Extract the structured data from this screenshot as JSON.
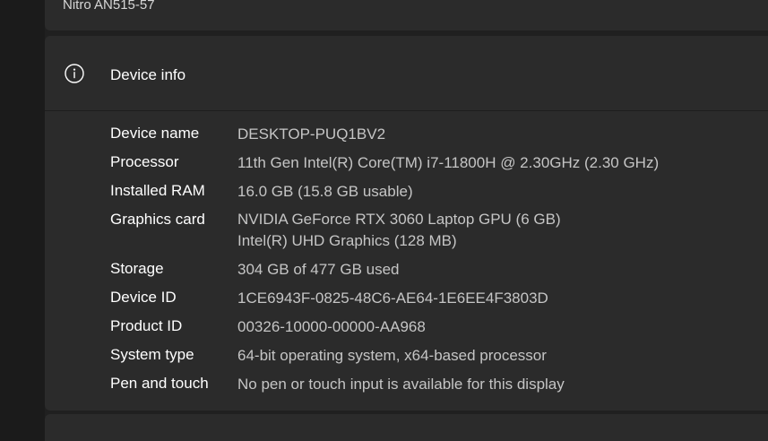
{
  "device_card": {
    "model": "Nitro AN515-57"
  },
  "device_info": {
    "title": "Device info",
    "icon": "info-icon",
    "specs": [
      {
        "label": "Device name",
        "values": [
          "DESKTOP-PUQ1BV2"
        ]
      },
      {
        "label": "Processor",
        "values": [
          "11th Gen Intel(R) Core(TM) i7-11800H @ 2.30GHz (2.30 GHz)"
        ]
      },
      {
        "label": "Installed RAM",
        "values": [
          "16.0 GB (15.8 GB usable)"
        ]
      },
      {
        "label": "Graphics card",
        "values": [
          "NVIDIA GeForce RTX 3060 Laptop GPU (6 GB)",
          "Intel(R) UHD Graphics (128 MB)"
        ]
      },
      {
        "label": "Storage",
        "values": [
          "304 GB of 477 GB used"
        ]
      },
      {
        "label": "Device ID",
        "values": [
          "1CE6943F-0825-48C6-AE64-1E6EE4F3803D"
        ]
      },
      {
        "label": "Product ID",
        "values": [
          "00326-10000-00000-AA968"
        ]
      },
      {
        "label": "System type",
        "values": [
          "64-bit operating system, x64-based processor"
        ]
      },
      {
        "label": "Pen and touch",
        "values": [
          "No pen or touch input is available for this display"
        ]
      }
    ]
  },
  "colors": {
    "background": "#202020",
    "card": "#2b2b2b",
    "label_text": "#ffffff",
    "value_text": "#c5c5c5"
  }
}
